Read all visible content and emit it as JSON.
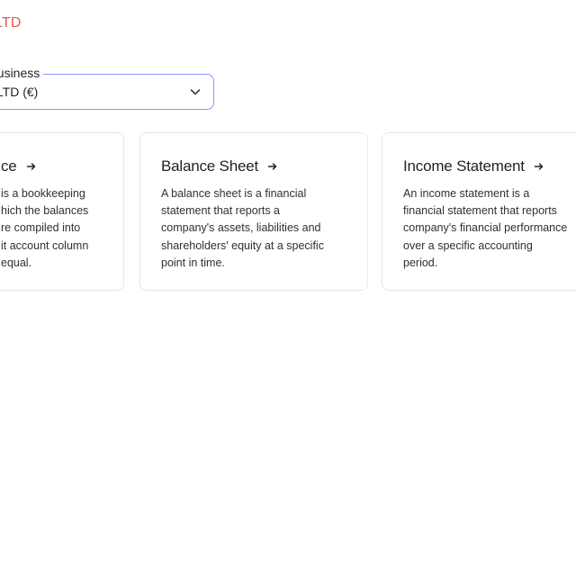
{
  "company": {
    "name": "LTD"
  },
  "business_select": {
    "label": "business",
    "value": "s LTD (€)"
  },
  "cards": [
    {
      "id": "trial",
      "title": "ce",
      "description": "is a bookkeeping\nhich the balances\nre compiled into\nit account column\nequal."
    },
    {
      "id": "balance",
      "title": "Balance Sheet",
      "description": "A balance sheet is a financial\nstatement that reports a\ncompany's assets, liabilities and\nshareholders' equity at a specific\npoint in time."
    },
    {
      "id": "income",
      "title": "Income Statement",
      "description": "An income statement is a\nfinancial statement that reports\ncompany's financial performance\nover a specific accounting\nperiod."
    }
  ],
  "colors": {
    "company_text": "#e05a55",
    "select_border": "#8b96ff",
    "card_border": "#e6e7ea"
  },
  "icons": {
    "chevron": "chevron-down-icon",
    "arrow": "arrow-right-icon"
  }
}
